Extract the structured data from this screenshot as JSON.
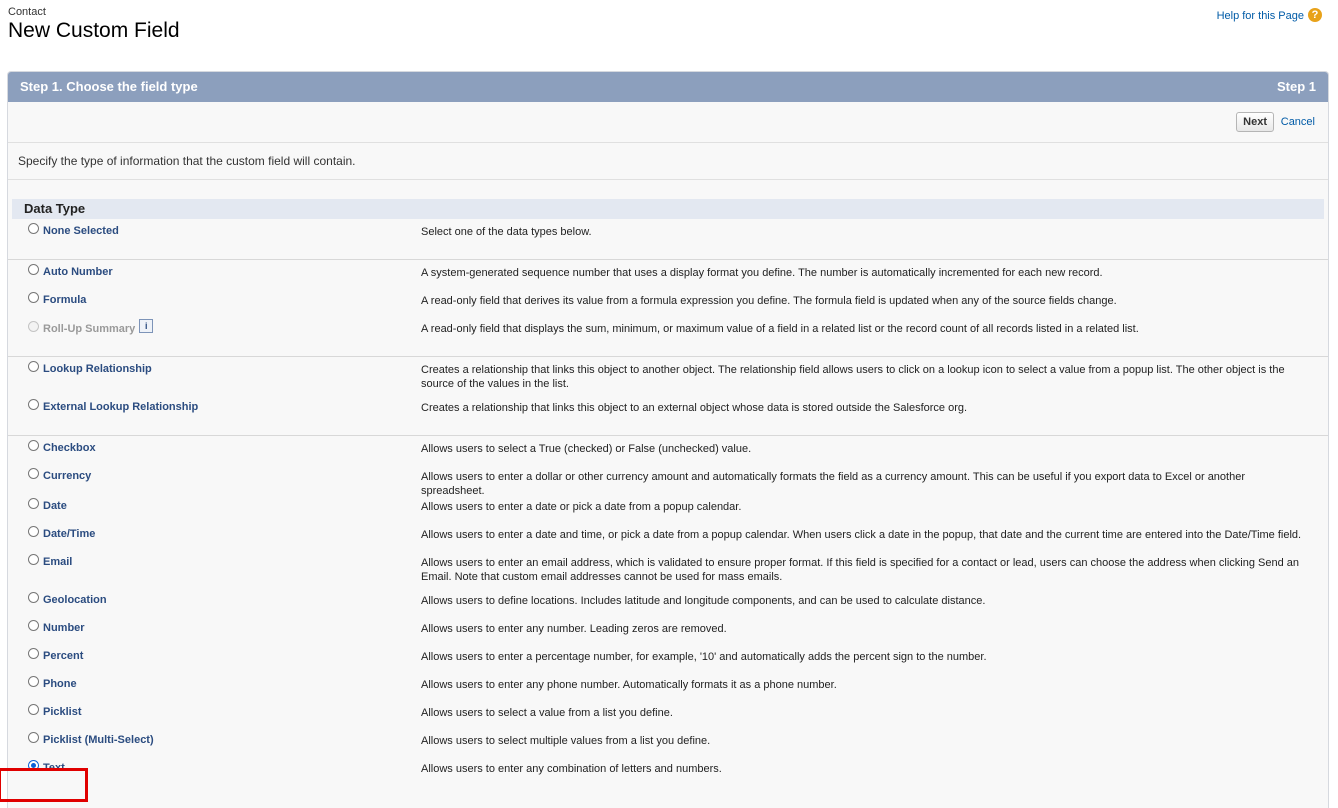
{
  "header": {
    "object_label": "Contact",
    "title": "New Custom Field",
    "help_link": "Help for this Page",
    "help_icon": "question-icon"
  },
  "step": {
    "title": "Step 1. Choose the field type",
    "indicator": "Step 1"
  },
  "buttons": {
    "next": "Next",
    "cancel": "Cancel"
  },
  "description": "Specify the type of information that the custom field will contain.",
  "section_title": "Data Type",
  "colors": {
    "step_bar": "#8c9fbd",
    "link": "#015ba7",
    "highlight": "#e00000"
  },
  "groups": [
    {
      "items": [
        {
          "label": "None Selected",
          "description": "Select one of the data types below.",
          "selected": false,
          "disabled": false
        }
      ]
    },
    {
      "items": [
        {
          "label": "Auto Number",
          "description": "A system-generated sequence number that uses a display format you define. The number is automatically incremented for each new record.",
          "selected": false,
          "disabled": false
        },
        {
          "label": "Formula",
          "description": "A read-only field that derives its value from a formula expression you define. The formula field is updated when any of the source fields change.",
          "selected": false,
          "disabled": false
        },
        {
          "label": "Roll-Up Summary",
          "description": "A read-only field that displays the sum, minimum, or maximum value of a field in a related list or the record count of all records listed in a related list.",
          "selected": false,
          "disabled": true,
          "info": "i"
        }
      ]
    },
    {
      "items": [
        {
          "label": "Lookup Relationship",
          "description": "Creates a relationship that links this object to another object. The relationship field allows users to click on a lookup icon to select a value from a popup list. The other object is the source of the values in the list.",
          "selected": false,
          "disabled": false
        },
        {
          "label": "External Lookup Relationship",
          "description": "Creates a relationship that links this object to an external object whose data is stored outside the Salesforce org.",
          "selected": false,
          "disabled": false
        }
      ]
    },
    {
      "items": [
        {
          "label": "Checkbox",
          "description": "Allows users to select a True (checked) or False (unchecked) value.",
          "selected": false,
          "disabled": false
        },
        {
          "label": "Currency",
          "description": "Allows users to enter a dollar or other currency amount and automatically formats the field as a currency amount. This can be useful if you export data to Excel or another spreadsheet.",
          "selected": false,
          "disabled": false
        },
        {
          "label": "Date",
          "description": "Allows users to enter a date or pick a date from a popup calendar.",
          "selected": false,
          "disabled": false
        },
        {
          "label": "Date/Time",
          "description": "Allows users to enter a date and time, or pick a date from a popup calendar. When users click a date in the popup, that date and the current time are entered into the Date/Time field.",
          "selected": false,
          "disabled": false
        },
        {
          "label": "Email",
          "description": "Allows users to enter an email address, which is validated to ensure proper format. If this field is specified for a contact or lead, users can choose the address when clicking Send an Email. Note that custom email addresses cannot be used for mass emails.",
          "selected": false,
          "disabled": false
        },
        {
          "label": "Geolocation",
          "description": "Allows users to define locations. Includes latitude and longitude components, and can be used to calculate distance.",
          "selected": false,
          "disabled": false
        },
        {
          "label": "Number",
          "description": "Allows users to enter any number. Leading zeros are removed.",
          "selected": false,
          "disabled": false
        },
        {
          "label": "Percent",
          "description": "Allows users to enter a percentage number, for example, '10' and automatically adds the percent sign to the number.",
          "selected": false,
          "disabled": false
        },
        {
          "label": "Phone",
          "description": "Allows users to enter any phone number. Automatically formats it as a phone number.",
          "selected": false,
          "disabled": false
        },
        {
          "label": "Picklist",
          "description": "Allows users to select a value from a list you define.",
          "selected": false,
          "disabled": false
        },
        {
          "label": "Picklist (Multi-Select)",
          "description": "Allows users to select multiple values from a list you define.",
          "selected": false,
          "disabled": false
        },
        {
          "label": "Text",
          "description": "Allows users to enter any combination of letters and numbers.",
          "selected": true,
          "disabled": false
        }
      ]
    }
  ]
}
